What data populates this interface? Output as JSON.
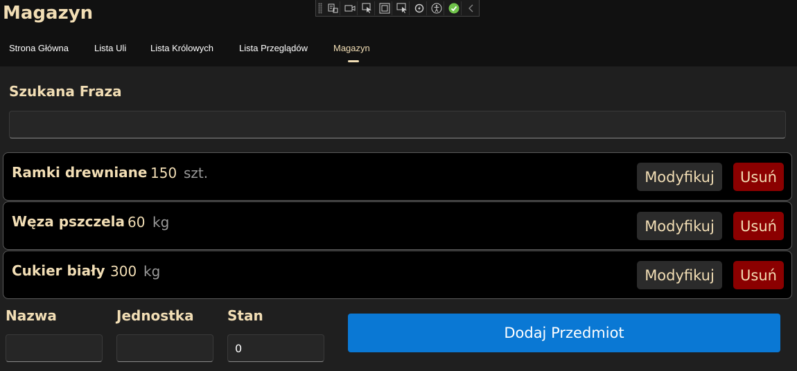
{
  "app": {
    "title": "Magazyn"
  },
  "nav": {
    "tabs": [
      {
        "label": "Strona Główna"
      },
      {
        "label": "Lista Uli"
      },
      {
        "label": "Lista Królowych"
      },
      {
        "label": "Lista Przeglądów"
      },
      {
        "label": "Magazyn",
        "active": true
      }
    ]
  },
  "debug_toolbar": {
    "icons": [
      "live-visual-tree-icon",
      "record-icon",
      "select-element-icon",
      "display-layout-adorners-icon",
      "track-focus-icon",
      "hot-reload-icon",
      "accessibility-icon",
      "status-ok-icon",
      "collapse-chevron-icon"
    ]
  },
  "search": {
    "label": "Szukana Fraza",
    "value": "",
    "placeholder": ""
  },
  "items": [
    {
      "name": "Ramki drewniane",
      "quantity": "150",
      "unit": "szt.",
      "modify_label": "Modyfikuj",
      "delete_label": "Usuń"
    },
    {
      "name": "Węza pszczela",
      "quantity": "60",
      "unit": "kg",
      "modify_label": "Modyfikuj",
      "delete_label": "Usuń"
    },
    {
      "name": "Cukier biały",
      "quantity": "300",
      "unit": "kg",
      "modify_label": "Modyfikuj",
      "delete_label": "Usuń"
    }
  ],
  "form": {
    "name_label": "Nazwa",
    "name_value": "",
    "unit_label": "Jednostka",
    "unit_value": "",
    "stock_label": "Stan",
    "stock_value": "0",
    "add_label": "Dodaj Przedmiot"
  },
  "colors": {
    "accent_text": "#f2deb5",
    "primary_button": "#0a78d4",
    "delete_button": "#8b0000",
    "background": "#1f1f1f"
  }
}
